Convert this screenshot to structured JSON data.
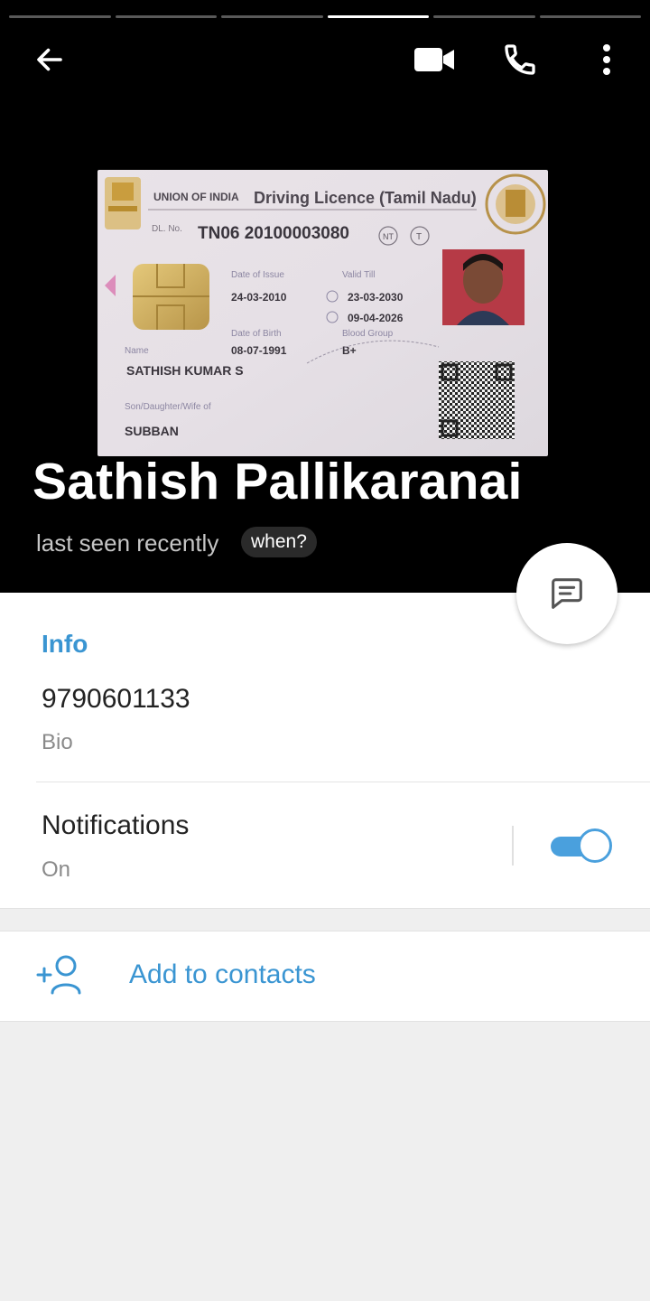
{
  "story": {
    "segments": 6,
    "active_index": 3
  },
  "toolbar": {
    "back_icon": "arrow-left-icon",
    "video_icon": "video-camera-icon",
    "call_icon": "phone-icon",
    "more_icon": "more-vertical-icon"
  },
  "profile": {
    "name": "Sathish Pallikaranai",
    "status": "last seen recently",
    "when_label": "when?",
    "message_icon": "message-icon"
  },
  "photo_card": {
    "heading_union": "UNION OF INDIA",
    "heading_title": "Driving Licence (Tamil Nadu)",
    "dl_label": "DL. No.",
    "dl_number": "TN06 20100003080",
    "badge_nt": "NT",
    "badge_t": "T",
    "date_of_issue_label": "Date of Issue",
    "date_of_issue": "24-03-2010",
    "valid_till_label": "Valid Till",
    "valid_nt": "23-03-2030",
    "valid_t": "09-04-2026",
    "dob_label": "Date of Birth",
    "dob": "08-07-1991",
    "blood_group_label": "Blood Group",
    "blood_group": "B+",
    "name_label": "Name",
    "holder_name": "SATHISH KUMAR S",
    "relation_label": "Son/Daughter/Wife of",
    "relation_name": "SUBBAN"
  },
  "info": {
    "section_title": "Info",
    "phone": "9790601133",
    "phone_label": "Bio",
    "notifications_label": "Notifications",
    "notifications_value": "On",
    "notifications_enabled": true
  },
  "actions": {
    "add_contact_label": "Add to contacts",
    "add_contact_icon": "add-user-icon"
  },
  "colors": {
    "accent": "#3a95d2",
    "toggle": "#4aa0dd",
    "header_bg": "#000000",
    "page_bg": "#efefef"
  }
}
